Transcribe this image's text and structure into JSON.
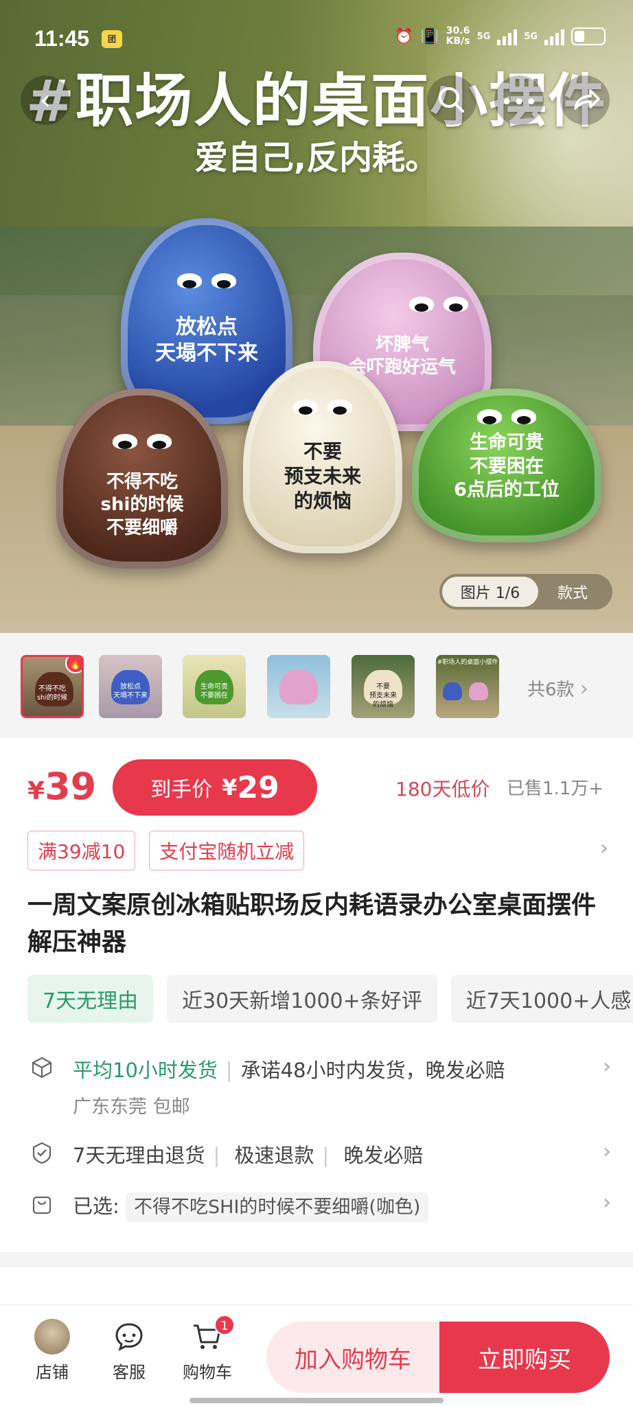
{
  "status_bar": {
    "time": "11:45",
    "badge": "团",
    "net_speed_value": "30.6",
    "net_speed_unit": "KB/s",
    "net1": "5G",
    "net2": "5G"
  },
  "hero": {
    "headline": "#职场人的桌面小摆件",
    "subline": "爱自己,反内耗。",
    "pieces": [
      {
        "text": "放松点\n天塌不下来",
        "color": "#2e56b8"
      },
      {
        "text": "坏脾气\n会吓跑好运气",
        "color": "#d8a6cf"
      },
      {
        "text": "不得不吃\nshi的时候\n不要细嚼",
        "color": "#6b3b2b"
      },
      {
        "text": "不要\n预支未来\n的烦恼",
        "color": "#ece3c9"
      },
      {
        "text": "生命可贵\n不要困在\n6点后的工位",
        "color": "#52a63a"
      }
    ],
    "photo_tab_active": "图片 1/6",
    "photo_tab_other": "款式"
  },
  "thumbs": {
    "items": [
      {
        "color": "#6b3b2b",
        "text": "不得不吃\nshi的时候"
      },
      {
        "color": "#3e5fc1",
        "text": "放松点\n天塌不下来"
      },
      {
        "color": "#52a63a",
        "text": "生命可贵\n不要困在"
      },
      {
        "color": "#e1a3cd",
        "text": ""
      },
      {
        "color": "#ece3c9",
        "text": "不要\n预支未来\n的烦恼"
      },
      {
        "color": "#8a7a5a",
        "text": "#职场人的桌面小摆件"
      }
    ],
    "hot_icon": "fire-icon",
    "count_label": "共6款"
  },
  "price": {
    "symbol": "¥",
    "value": "39",
    "final_label": "到手价",
    "final_symbol": "¥",
    "final_value": "29",
    "lowest_label": "180天低价",
    "sold_label": "已售1.1万+"
  },
  "coupons": [
    "满39减10",
    "支付宝随机立减"
  ],
  "title": "一周文案原创冰箱贴职场反内耗语录办公室桌面摆件解压神器",
  "tags": [
    "7天无理由",
    "近30天新增1000+条好评",
    "近7天1000+人感"
  ],
  "services": {
    "shipping_highlight": "平均10小时发货",
    "shipping_promise": "承诺48小时内发货，晚发必赔",
    "shipping_origin": "广东东莞 包邮",
    "returns": [
      "7天无理由退货",
      "极速退款",
      "晚发必赔"
    ],
    "selected_label": "已选:",
    "selected_value": "不得不吃SHI的时候不要细嚼(咖色)"
  },
  "bottom_bar": {
    "shop": "店铺",
    "service": "客服",
    "cart": "购物车",
    "cart_count": "1",
    "add_to_cart": "加入购物车",
    "buy_now": "立即购买"
  },
  "colors": {
    "accent": "#e8384c",
    "green": "#2a9a6a"
  }
}
